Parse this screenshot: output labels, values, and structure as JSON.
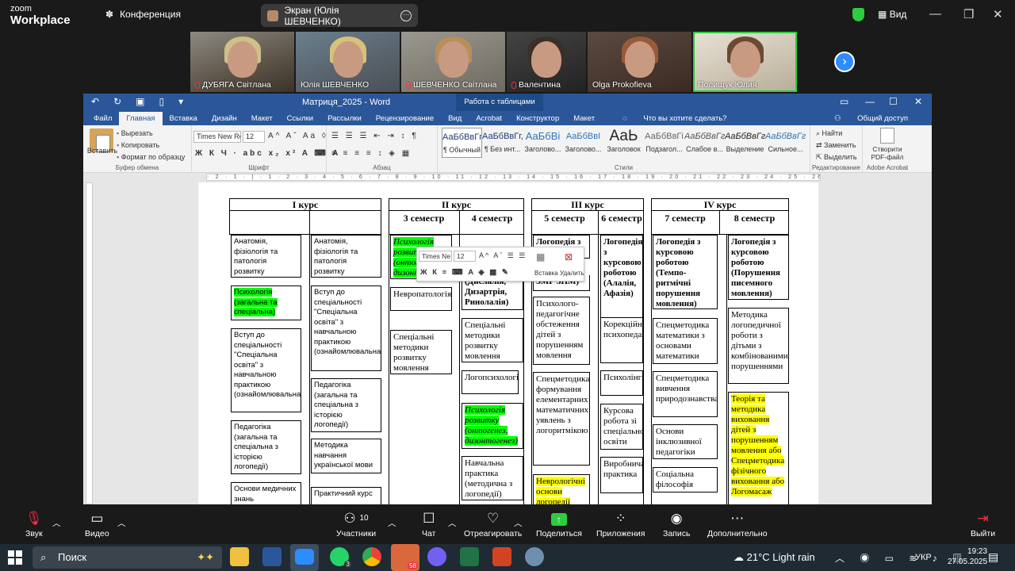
{
  "zoom": {
    "logo_top": "zoom",
    "logo_bottom": "Workplace",
    "meeting_label": "Конференция",
    "screen_share_label": "Экран (Юлія ШЕВЧЕНКО)",
    "view_label": "Вид",
    "participants": [
      {
        "name": "ДУБЯГА Світлана",
        "muted": true
      },
      {
        "name": "Юлія ШЕВЧЕНКО",
        "muted": false
      },
      {
        "name": "ШЕВЧЕНКО Світлана",
        "muted": true
      },
      {
        "name": "Валентина",
        "muted": true
      },
      {
        "name": "Olga Prokofieva",
        "muted": false
      },
      {
        "name": "Полищук Юлия",
        "muted": false
      }
    ],
    "controls": [
      {
        "label": "Звук",
        "icon": "microphone-muted-icon"
      },
      {
        "label": "Видео",
        "icon": "video-camera-icon"
      },
      {
        "label": "Участники",
        "icon": "participants-icon",
        "count": "10"
      },
      {
        "label": "Чат",
        "icon": "chat-icon"
      },
      {
        "label": "Отреагировать",
        "icon": "heart-icon"
      },
      {
        "label": "Поделиться",
        "icon": "share-screen-icon"
      },
      {
        "label": "Приложения",
        "icon": "apps-icon"
      },
      {
        "label": "Запись",
        "icon": "record-icon"
      },
      {
        "label": "Дополнительно",
        "icon": "more-icon"
      },
      {
        "label": "Выйти",
        "icon": "leave-icon"
      }
    ]
  },
  "word": {
    "title": "Матриця_2025 - Word",
    "context_tab": "Работа с таблицами",
    "tabs": [
      "Файл",
      "Главная",
      "Вставка",
      "Дизайн",
      "Макет",
      "Ссылки",
      "Рассылки",
      "Рецензирование",
      "Вид",
      "Acrobat",
      "Конструктор",
      "Макет"
    ],
    "tell_me": "Что вы хотите сделать?",
    "share": "Общий доступ",
    "clipboard": {
      "paste": "Вставить",
      "cut": "Вырезать",
      "copy": "Копировать",
      "format_painter": "Формат по образцу",
      "group": "Буфер обмена"
    },
    "font": {
      "name": "Times New Ro",
      "size": "12",
      "group": "Шрифт"
    },
    "paragraph_group": "Абзац",
    "styles": {
      "group": "Стили",
      "items": [
        {
          "preview": "АаБбВвГг,",
          "name": "¶ Обычный"
        },
        {
          "preview": "АаБбВвГг,",
          "name": "¶ Без инт..."
        },
        {
          "preview": "АаБбВі",
          "name": "Заголово..."
        },
        {
          "preview": "АаБбВвІ",
          "name": "Заголово..."
        },
        {
          "preview": "АаЬ",
          "name": "Заголовок"
        },
        {
          "preview": "АаБбВвГі",
          "name": "Подзагол..."
        },
        {
          "preview": "АаБбВвГг,",
          "name": "Слабое в..."
        },
        {
          "preview": "АаБбВвГг,",
          "name": "Выделение"
        },
        {
          "preview": "АаБбВвГг,",
          "name": "Сильное..."
        }
      ]
    },
    "editing": {
      "find": "Найти",
      "replace": "Заменить",
      "select": "Выделить",
      "group": "Редактирование"
    },
    "pdf": {
      "label": "Створити PDF-файл",
      "group": "Adobe Acrobat"
    },
    "ruler_text": "· 2 · 1 · | · 1 · 2 · 3 · 4 · 5 · 6 · 7 · 8 · 9 · 10 · 11 · 12 · 13 · 14 · 15 · 16 · 17 · 18 · 19 · 20 · 21 · 22 · 23 · 24 · 25 · 26 · 27 ·"
  },
  "floatbar": {
    "font": "Times Ne",
    "size": "12",
    "insert": "Вставка",
    "delete": "Удалить"
  },
  "matrix": {
    "course1": {
      "title": "I курс",
      "col1": [
        "Анатомія, фізіологія та патологія розвитку",
        "Психологія (загальна та спеціальна)",
        "Вступ до спеціальності \"Спеціальна освіта\" з навчальною практикою (ознайомлювальна)",
        "Педагогіка (загальна та спеціальна з історією логопедії)",
        "Основи медичних знань"
      ],
      "col2": [
        "Анатомія, фізіологія та патологія розвитку",
        "Вступ до спеціальності \"Спеціальна освіта\" з навчальною практикою (ознайомлювальна)",
        "Педагогіка (загальна та спеціальна з історією логопедії)",
        "Методика навчання української мови",
        "Практичний курс"
      ]
    },
    "course2": {
      "title": "II курс",
      "sem3": "3 семестр",
      "sem4": "4 семестр",
      "col3": [
        "Психологія розвитку (онтогенез, дизонтогенез)",
        "Невропатологія",
        "Спеціальні методики розвитку мовлення"
      ],
      "col4": [
        "(Дислалія, Дизартрія, Ринолалія)",
        "Спеціальні методики розвитку мовлення",
        "Логопсихологія",
        "Психологія розвитку (онтогенез, дизонтогенез)",
        "Навчальна практика (методична з логопедії)"
      ]
    },
    "course3": {
      "title": "III курс",
      "sem5": "5 семестр",
      "sem6": "6 семестр",
      "col5": [
        "Логопедія з",
        "ЗМР ЗНМ)",
        "Психолого-педагогічне обстеження дітей з порушенням мовлення",
        "Спецметодика формування елементарних математичних уявлень з логоритмікою",
        "Неврологічні основи логопедії"
      ],
      "col6": [
        "Логопедія з курсовою роботою (Алалія, Афазія)",
        "Корекційна психопедагогіка",
        "Психолінгвістика",
        "Курсова робота зі спеціальної освіти",
        "Виробнича практика"
      ]
    },
    "course4": {
      "title": "IV курс",
      "sem7": "7 семестр",
      "sem8": "8 семестр",
      "col7": [
        "Логопедія з курсовою роботою (Темпо-ритмічні порушення мовлення)",
        "Спецметодика математики з основами математики",
        "Спецметодика вивчення природознавства",
        "Основи інклюзивної педагогіки",
        "Соціальна філософія"
      ],
      "col8": [
        "Логопедія з курсовою роботою (Порушення писемного мовлення)",
        "Методика логопедичної роботи з дітьми з комбінованими порушеннями",
        "Теорія та методика виховання дітей з порушенням мовлення або Спецметодика фізічного виховання або Логомасаж"
      ]
    }
  },
  "taskbar": {
    "search": "Поиск",
    "weather": "21°C  Light rain",
    "lang": "УКР",
    "time": "19:23",
    "date": "27.05.2025",
    "badge_whatsapp": "3",
    "badge_telegram": "58"
  }
}
